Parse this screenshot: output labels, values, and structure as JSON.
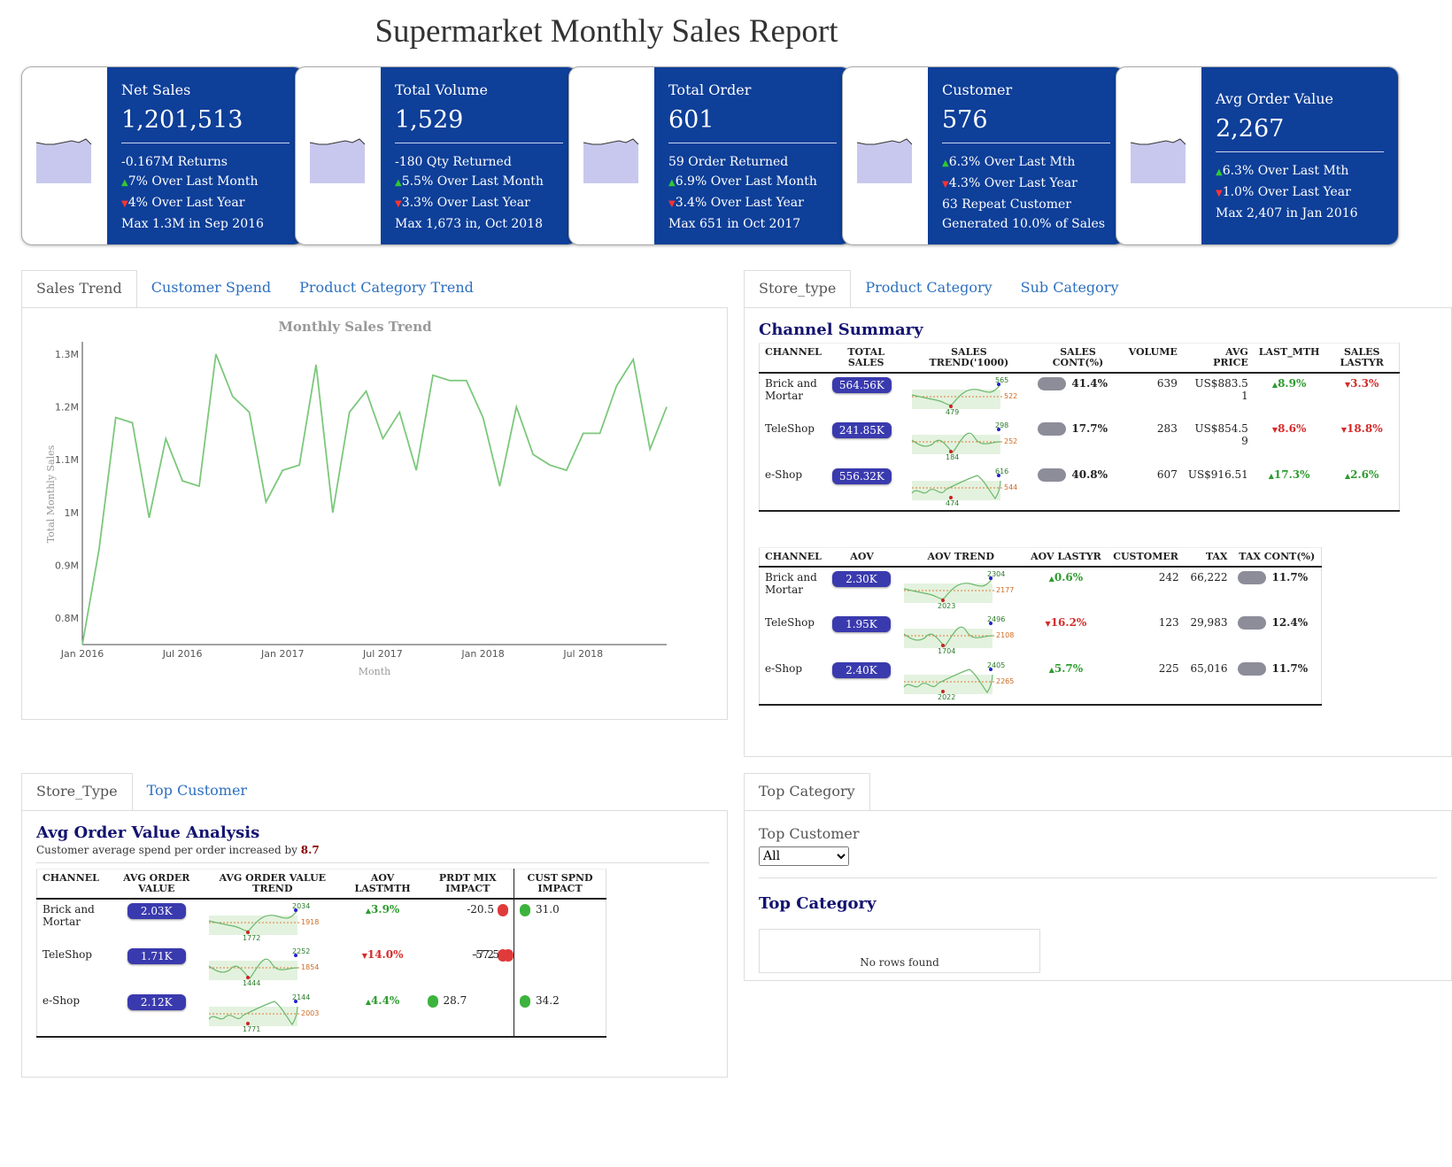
{
  "title": "Supermarket Monthly Sales Report",
  "kpis": [
    {
      "label": "Net Sales",
      "value": "1,201,513",
      "lines": [
        {
          "arrow": "",
          "text": "-0.167M Returns"
        },
        {
          "arrow": "up",
          "text": "7% Over Last Month"
        },
        {
          "arrow": "down",
          "text": "4% Over Last Year"
        },
        {
          "arrow": "",
          "text": "Max 1.3M in Sep 2016"
        }
      ]
    },
    {
      "label": "Total Volume",
      "value": "1,529",
      "lines": [
        {
          "arrow": "",
          "text": "-180 Qty Returned"
        },
        {
          "arrow": "up",
          "text": "5.5% Over Last Month"
        },
        {
          "arrow": "down",
          "text": "3.3% Over Last Year"
        },
        {
          "arrow": "",
          "text": "Max 1,673 in, Oct 2018"
        }
      ]
    },
    {
      "label": "Total Order",
      "value": "601",
      "lines": [
        {
          "arrow": "",
          "text": "59 Order Returned"
        },
        {
          "arrow": "up",
          "text": "6.9% Over Last Month"
        },
        {
          "arrow": "down",
          "text": "3.4% Over Last Year"
        },
        {
          "arrow": "",
          "text": "Max 651 in Oct 2017"
        }
      ]
    },
    {
      "label": "Customer",
      "value": "576",
      "lines": [
        {
          "arrow": "up",
          "text": "6.3% Over Last Mth"
        },
        {
          "arrow": "down",
          "text": "4.3% Over Last Year"
        },
        {
          "arrow": "",
          "text": "63 Repeat Customer"
        },
        {
          "arrow": "",
          "text": "Generated 10.0% of Sales"
        }
      ]
    },
    {
      "label": "Avg Order Value",
      "value": "2,267",
      "lines": [
        {
          "arrow": "up",
          "text": "6.3% Over Last Mth"
        },
        {
          "arrow": "down",
          "text": "1.0% Over Last Year"
        },
        {
          "arrow": "",
          "text": "Max 2,407 in Jan 2016"
        }
      ]
    }
  ],
  "trend_panel": {
    "tabs": [
      "Sales Trend",
      "Customer Spend",
      "Product Category Trend"
    ],
    "active_tab": 0
  },
  "chart_data": {
    "type": "line",
    "title": "Monthly Sales Trend",
    "xlabel": "Month",
    "ylabel": "Total Monthly Sales",
    "x_tick_labels": [
      "Jan 2016",
      "Jul 2016",
      "Jan 2017",
      "Jul 2017",
      "Jan 2018",
      "Jul 2018"
    ],
    "y_tick_labels": [
      "1.3M",
      "1.2M",
      "1.1M",
      "1M",
      "0.9M",
      "0.8M"
    ],
    "ylim": [
      0.75,
      1.32
    ],
    "x_range_months": [
      0,
      35
    ],
    "color": "#7cc87c",
    "series": [
      {
        "values": [
          0.75,
          0.93,
          1.18,
          1.17,
          0.99,
          1.14,
          1.06,
          1.05,
          1.3,
          1.22,
          1.19,
          1.02,
          1.08,
          1.09,
          1.28,
          1.0,
          1.19,
          1.23,
          1.14,
          1.19,
          1.08,
          1.26,
          1.25,
          1.25,
          1.18,
          1.05,
          1.2,
          1.11,
          1.09,
          1.08,
          1.15,
          1.15,
          1.24,
          1.29,
          1.12,
          1.2
        ]
      }
    ],
    "grid": false
  },
  "channel_panel": {
    "tabs": [
      "Store_type",
      "Product Category",
      "Sub Category"
    ],
    "active_tab": 0,
    "summary_title": "Channel Summary",
    "table1": {
      "headers": [
        "CHANNEL",
        "TOTAL SALES",
        "SALES TREND('1000)",
        "SALES CONT(%)",
        "VOLUME",
        "AVG PRICE",
        "LAST_MTH",
        "SALES LASTYR"
      ],
      "rows": [
        {
          "channel": "Brick and Mortar",
          "total": "564.56K",
          "spark": {
            "max": "565",
            "min": "479",
            "last": "522"
          },
          "cont": "41.4%",
          "volume": "639",
          "avg_price": "US$883.5 1",
          "last_mth": "8.9%",
          "last_mth_dir": "up",
          "lastyr": "3.3%",
          "lastyr_dir": "down"
        },
        {
          "channel": "TeleShop",
          "total": "241.85K",
          "spark": {
            "max": "298",
            "min": "184",
            "last": "252"
          },
          "cont": "17.7%",
          "volume": "283",
          "avg_price": "US$854.5 9",
          "last_mth": "8.6%",
          "last_mth_dir": "down",
          "lastyr": "18.8%",
          "lastyr_dir": "down"
        },
        {
          "channel": "e-Shop",
          "total": "556.32K",
          "spark": {
            "max": "616",
            "min": "474",
            "last": "544"
          },
          "cont": "40.8%",
          "volume": "607",
          "avg_price": "US$916.51",
          "last_mth": "17.3%",
          "last_mth_dir": "up",
          "lastyr": "2.6%",
          "lastyr_dir": "up"
        }
      ]
    },
    "table2": {
      "headers": [
        "CHANNEL",
        "AOV",
        "AOV TREND",
        "AOV LASTYR",
        "CUSTOMER",
        "TAX",
        "TAX CONT(%)"
      ],
      "rows": [
        {
          "channel": "Brick and Mortar",
          "aov": "2.30K",
          "spark": {
            "max": "2304",
            "min": "2023",
            "last": "2177"
          },
          "lastyr": "0.6%",
          "lastyr_dir": "up",
          "customer": "242",
          "tax": "66,222",
          "tax_cont": "11.7%"
        },
        {
          "channel": "TeleShop",
          "aov": "1.95K",
          "spark": {
            "max": "2496",
            "min": "1704",
            "last": "2108"
          },
          "lastyr": "16.2%",
          "lastyr_dir": "down",
          "customer": "123",
          "tax": "29,983",
          "tax_cont": "12.4%"
        },
        {
          "channel": "e-Shop",
          "aov": "2.40K",
          "spark": {
            "max": "2405",
            "min": "2022",
            "last": "2265"
          },
          "lastyr": "5.7%",
          "lastyr_dir": "up",
          "customer": "225",
          "tax": "65,016",
          "tax_cont": "11.7%"
        }
      ]
    }
  },
  "aov_panel": {
    "tabs": [
      "Store_Type",
      "Top Customer"
    ],
    "active_tab": 0,
    "title": "Avg Order Value Analysis",
    "subtitle": "Customer average spend per order increased by",
    "subtitle_value": "8.7",
    "headers": [
      "CHANNEL",
      "AVG ORDER VALUE",
      "AVG ORDER VALUE TREND",
      "AOV LASTMTH",
      "PRDT MIX IMPACT",
      "CUST SPND IMPACT"
    ],
    "rows": [
      {
        "channel": "Brick and Mortar",
        "aov": "2.03K",
        "spark": {
          "max": "2034",
          "min": "1772",
          "last": "1918"
        },
        "lastmth": "3.9%",
        "lastmth_dir": "up",
        "prdt": "-20.5",
        "prdt_sign": "neg",
        "cust": "31.0",
        "cust_sign": "pos"
      },
      {
        "channel": "TeleShop",
        "aov": "1.71K",
        "spark": {
          "max": "2252",
          "min": "1444",
          "last": "1854"
        },
        "lastmth": "14.0%",
        "lastmth_dir": "down",
        "prdt": "-7.2",
        "prdt_sign": "neg",
        "cust": "-57.5",
        "cust_sign": "neg"
      },
      {
        "channel": "e-Shop",
        "aov": "2.12K",
        "spark": {
          "max": "2144",
          "min": "1771",
          "last": "2003"
        },
        "lastmth": "4.4%",
        "lastmth_dir": "up",
        "prdt": "28.7",
        "prdt_sign": "pos",
        "cust": "34.2",
        "cust_sign": "pos"
      }
    ]
  },
  "top_panel": {
    "tab": "Top Category",
    "filter_label": "Top Customer",
    "filter_value": "All",
    "section_title": "Top Category",
    "empty_text": "No rows found"
  }
}
